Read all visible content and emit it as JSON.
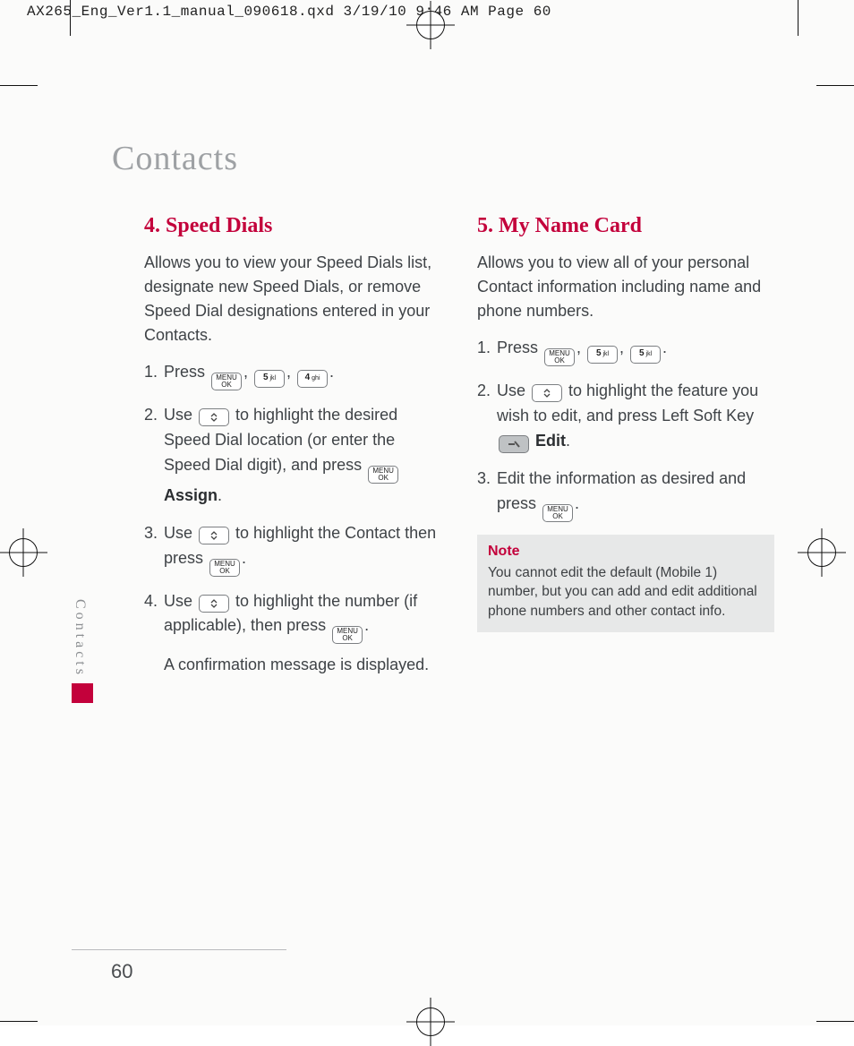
{
  "slug": "AX265_Eng_Ver1.1_manual_090618.qxd  3/19/10  9:46 AM  Page 60",
  "chapter_title": "Contacts",
  "side_tab": "Contacts",
  "page_number": "60",
  "left": {
    "heading": "4. Speed Dials",
    "intro": "Allows you to view your Speed Dials list, designate new Speed Dials, or remove Speed Dial designations entered in your Contacts.",
    "step1_pre": "Press ",
    "step2_a": "Use ",
    "step2_b": " to highlight the desired Speed Dial location (or enter the Speed Dial digit), and press ",
    "step2_bold": "Assign",
    "step3_a": "Use ",
    "step3_b": " to highlight the Contact then press ",
    "step4_a": "Use ",
    "step4_b": " to highlight the number (if applicable), then press ",
    "step4_sub": "A confirmation message is displayed."
  },
  "right": {
    "heading": "5. My Name Card",
    "intro": "Allows you to view all of your personal Contact information including name and phone numbers.",
    "step1_pre": "Press ",
    "step2_a": "Use ",
    "step2_b": " to highlight the feature you wish to edit, and press Left Soft Key ",
    "step2_bold": "Edit",
    "step3_a": "Edit the information as desired and press "
  },
  "note": {
    "heading": "Note",
    "body": "You cannot edit the default (Mobile 1) number, but you can add and edit additional phone numbers and other contact info."
  },
  "keys": {
    "menu_ok_top": "MENU",
    "menu_ok_bot": "OK",
    "five_main": "5",
    "five_sub": "jkl",
    "four_main": "4",
    "four_sub": "ghi"
  }
}
